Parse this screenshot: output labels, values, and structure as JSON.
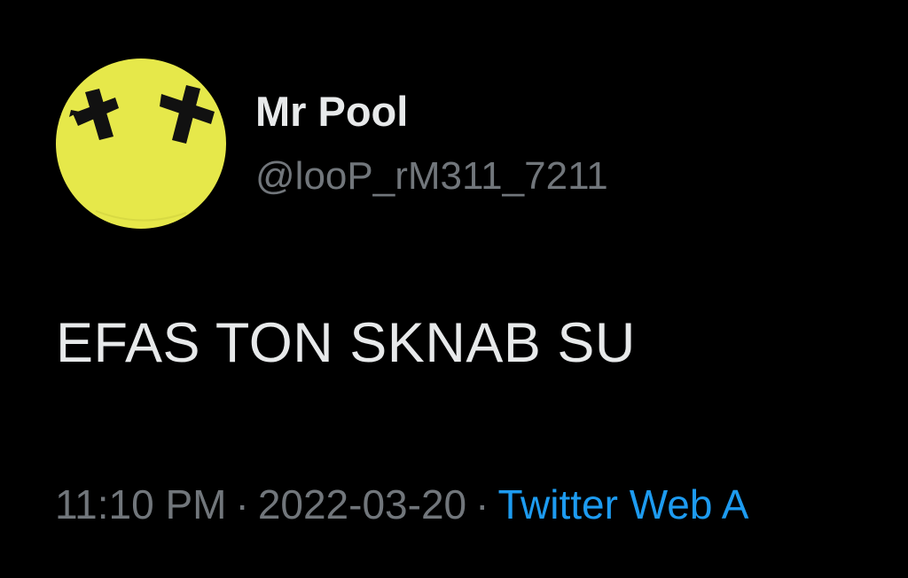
{
  "tweet": {
    "author": {
      "display_name": "Mr Pool",
      "handle": "@looP_rM311_7211",
      "avatar_icon": "smiley-face-avatar-icon",
      "avatar_color": "#e6e84a"
    },
    "text": "EFAS TON SKNAB SU",
    "time": "11:10 PM",
    "separator": "·",
    "date": "2022-03-20",
    "source": "Twitter Web A"
  },
  "colors": {
    "background": "#000000",
    "primary_text": "#e7e9ea",
    "secondary_text": "#71767b",
    "link": "#1d9bf0"
  }
}
